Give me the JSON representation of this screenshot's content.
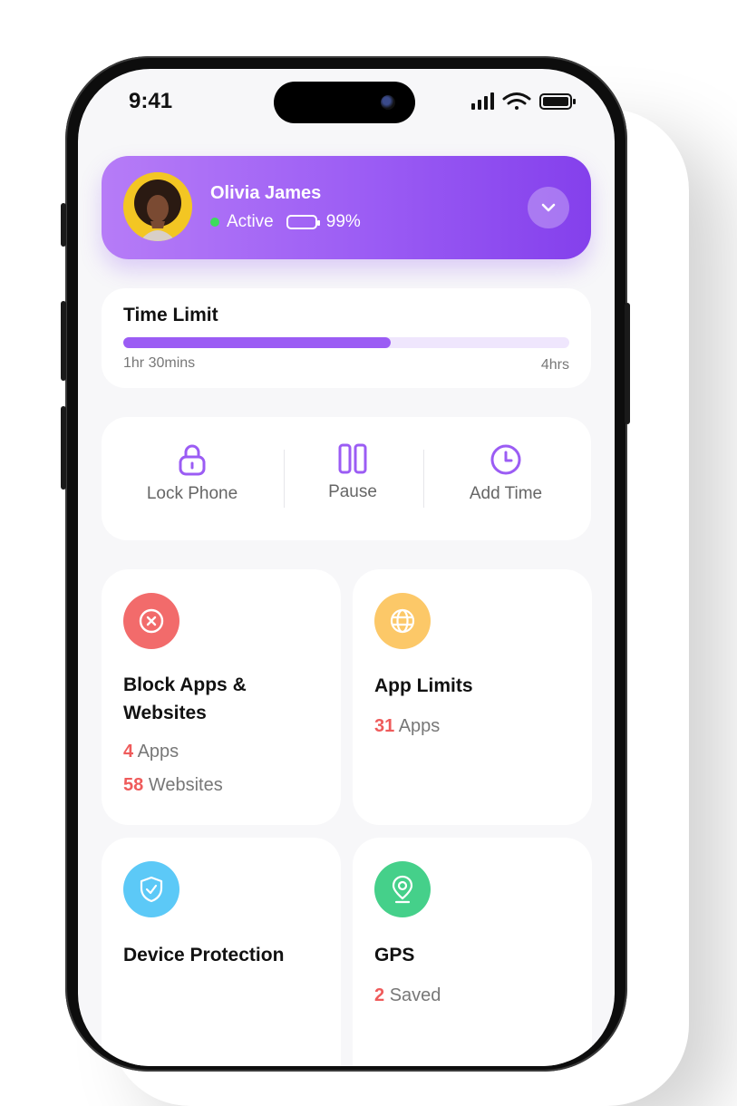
{
  "status_bar": {
    "time": "9:41"
  },
  "profile": {
    "name": "Olivia James",
    "status": "Active",
    "battery": "99%",
    "battery_level": 0.99
  },
  "time_limit": {
    "title": "Time Limit",
    "used": "1hr 30mins",
    "max": "4hrs",
    "progress": 0.6
  },
  "actions": [
    {
      "label": "Lock Phone",
      "icon": "lock-icon"
    },
    {
      "label": "Pause",
      "icon": "pause-icon"
    },
    {
      "label": "Add Time",
      "icon": "clock-icon"
    }
  ],
  "features": {
    "block": {
      "title": "Block Apps & Websites",
      "icon": "block-icon",
      "color": "#f26b6b",
      "apps_count": "4",
      "apps_label": "Apps",
      "sites_count": "58",
      "sites_label": "Websites"
    },
    "limits": {
      "title": "App Limits",
      "icon": "globe-icon",
      "color": "#fcc868",
      "apps_count": "31",
      "apps_label": "Apps"
    },
    "protection": {
      "title": "Device Protection",
      "icon": "shield-icon",
      "color": "#5cc9f7"
    },
    "gps": {
      "title": "GPS",
      "icon": "location-icon",
      "color": "#45d08a",
      "saved_count": "2",
      "saved_label": "Saved"
    }
  },
  "colors": {
    "accent": "#9b5cf4",
    "highlight": "#ef5b5b"
  }
}
